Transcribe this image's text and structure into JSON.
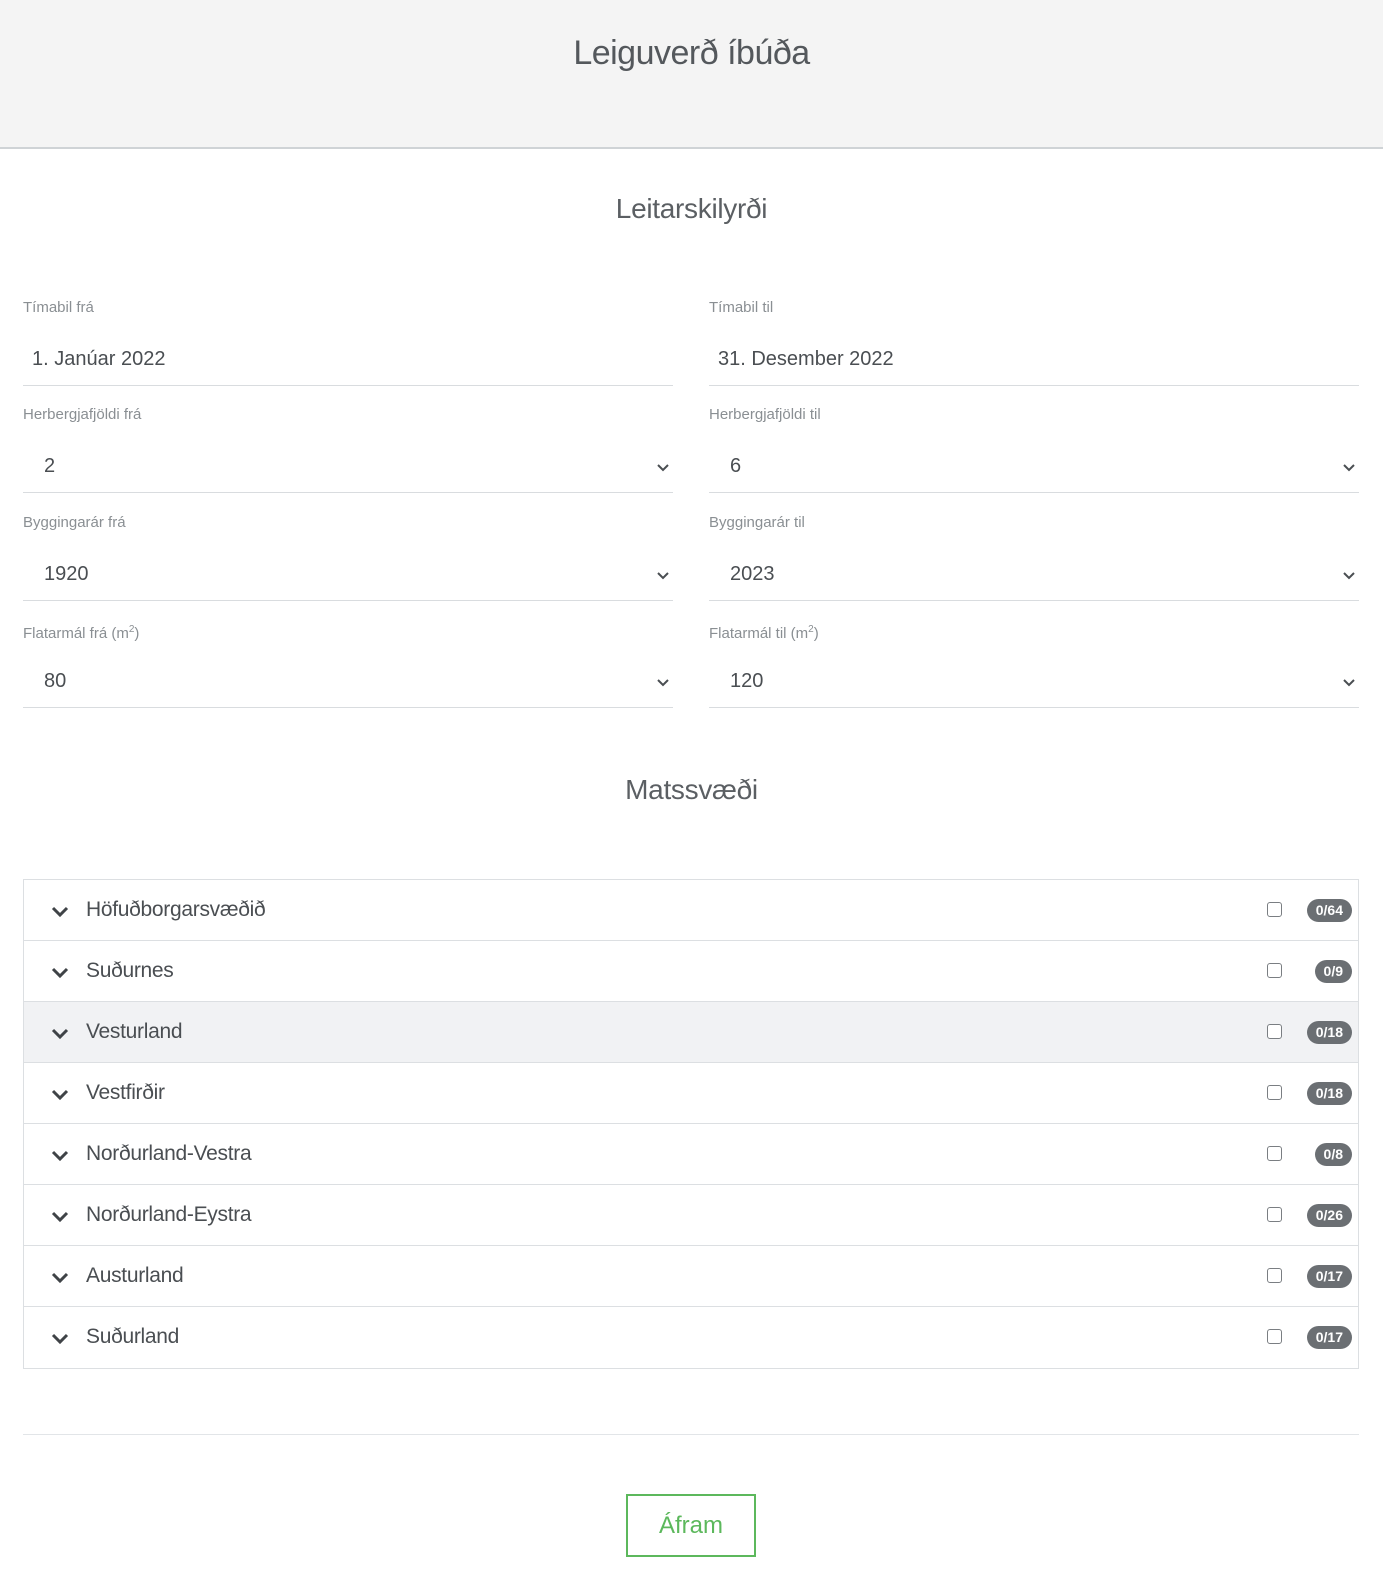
{
  "header": {
    "title": "Leiguverð íbúða"
  },
  "criteria": {
    "title": "Leitarskilyrði",
    "period_from": {
      "label": "Tímabil frá",
      "value": "1. Janúar 2022"
    },
    "period_to": {
      "label": "Tímabil til",
      "value": "31. Desember 2022"
    },
    "rooms_from": {
      "label": "Herbergjafjöldi frá",
      "value": "2"
    },
    "rooms_to": {
      "label": "Herbergjafjöldi til",
      "value": "6"
    },
    "year_from": {
      "label": "Byggingarár frá",
      "value": "1920"
    },
    "year_to": {
      "label": "Byggingarár til",
      "value": "2023"
    },
    "area_from": {
      "label_prefix": "Flatarmál frá (m",
      "label_sup": "2",
      "label_suffix": ")",
      "value": "80"
    },
    "area_to": {
      "label_prefix": "Flatarmál til (m",
      "label_sup": "2",
      "label_suffix": ")",
      "value": "120"
    }
  },
  "regions": {
    "title": "Matssvæði",
    "items": [
      {
        "name": "Höfuðborgarsvæðið",
        "count": "0/64"
      },
      {
        "name": "Suðurnes",
        "count": "0/9"
      },
      {
        "name": "Vesturland",
        "count": "0/18"
      },
      {
        "name": "Vestfirðir",
        "count": "0/18"
      },
      {
        "name": "Norðurland-Vestra",
        "count": "0/8"
      },
      {
        "name": "Norðurland-Eystra",
        "count": "0/26"
      },
      {
        "name": "Austurland",
        "count": "0/17"
      },
      {
        "name": "Suðurland",
        "count": "0/17"
      }
    ]
  },
  "footer": {
    "continue_label": "Áfram"
  },
  "colors": {
    "accent": "#5cb85c",
    "badge": "#6b6f73",
    "header_bg": "#f4f4f4"
  },
  "icons": {
    "select": "chevron-down-icon",
    "region_toggle": "chevron-down-icon"
  }
}
